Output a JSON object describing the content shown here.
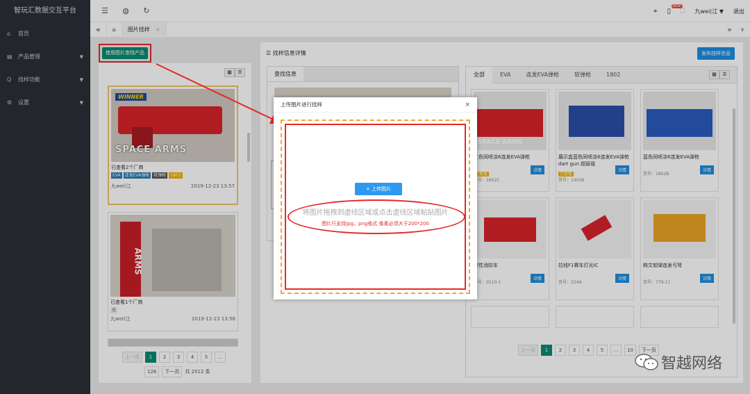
{
  "app": {
    "title": "智玩汇数据交互平台"
  },
  "sidebar": {
    "items": [
      {
        "icon": "⌂",
        "label": "首页"
      },
      {
        "icon": "▤",
        "label": "产品管理",
        "arrow": "▼"
      },
      {
        "icon": "Q",
        "label": "找样功能",
        "arrow": "▼"
      },
      {
        "icon": "⚙",
        "label": "设置",
        "arrow": "▼"
      }
    ]
  },
  "topbar": {
    "icons": [
      "☰",
      "◍",
      "↻"
    ],
    "user": "九wei(江",
    "user_caret": "▼",
    "logout": "退出",
    "new_badge": "NEW"
  },
  "tabs": {
    "prev": "«",
    "home": "⌂",
    "active_label": "图片找样",
    "close": "×",
    "next": "»",
    "dropdown": "∨"
  },
  "toolbar": {
    "image_search_button": "使用图片查找产品"
  },
  "left": {
    "cards": [
      {
        "brand": "WINNER",
        "title": "SPACE ARMS",
        "seen": "已查看2个厂商",
        "tags": [
          "EVA",
          "连发EVA弹枪",
          "软弹枪",
          "1802"
        ],
        "user": "九wei(江",
        "date": "2019-12-23 13:57"
      },
      {
        "brand": "",
        "title": "ARMS",
        "seen": "已查看1个厂商",
        "tags": [
          "无"
        ],
        "user": "九wei(江",
        "date": "2019-12-23 13:56"
      }
    ],
    "pager": {
      "prev": "上一页",
      "pages": [
        "1",
        "2",
        "3",
        "4",
        "5",
        "..."
      ],
      "last": "126",
      "next": "下一页",
      "total": "共 2512 条"
    }
  },
  "right": {
    "title": "找样信息详情",
    "publish_button": "发布找样信息",
    "subtab": "查找信息",
    "grid_tabs": [
      "全部",
      "EVA",
      "连发EVA弹枪",
      "软弹枪",
      "1802"
    ],
    "products": [
      {
        "name": "红色同喷涂6连发EVA弹枪",
        "tag": "已查看",
        "sn": "货号：1802C",
        "btn": "详情"
      },
      {
        "name": "展示盒蓝色同喷涂6连发EVA弹枪 dart gun 超级碰",
        "tag": "已查看",
        "sn": "货号：1402B",
        "btn": "详情"
      },
      {
        "name": "蓝色同喷涂6连发EVA弹枪",
        "tag": "",
        "sn": "货号：1802B",
        "btn": "详情"
      },
      {
        "name": "惯性消防车",
        "tag": "",
        "sn": "货号：0510-1",
        "btn": "详情"
      },
      {
        "name": "拉线F1赛车灯光IC",
        "tag": "",
        "sn": "货号：224A",
        "btn": "详情"
      },
      {
        "name": "韩文软弹连发弓弩",
        "tag": "",
        "sn": "货号：779-11",
        "btn": "详情"
      }
    ],
    "pager": {
      "prev": "上一页",
      "pages": [
        "1",
        "2",
        "3",
        "4",
        "5",
        "...",
        "10"
      ],
      "next": "下一页"
    }
  },
  "modal": {
    "title": "上传图片进行找样",
    "close": "×",
    "upload_button": "+ 上传图片",
    "hint_main": "将图片拖拽到虚线区域或点击虚线区域粘贴图片",
    "hint_sub": "图片只支持jpg，png格式 像素必须大于200*200"
  },
  "watermark": {
    "text": "智越网络"
  }
}
